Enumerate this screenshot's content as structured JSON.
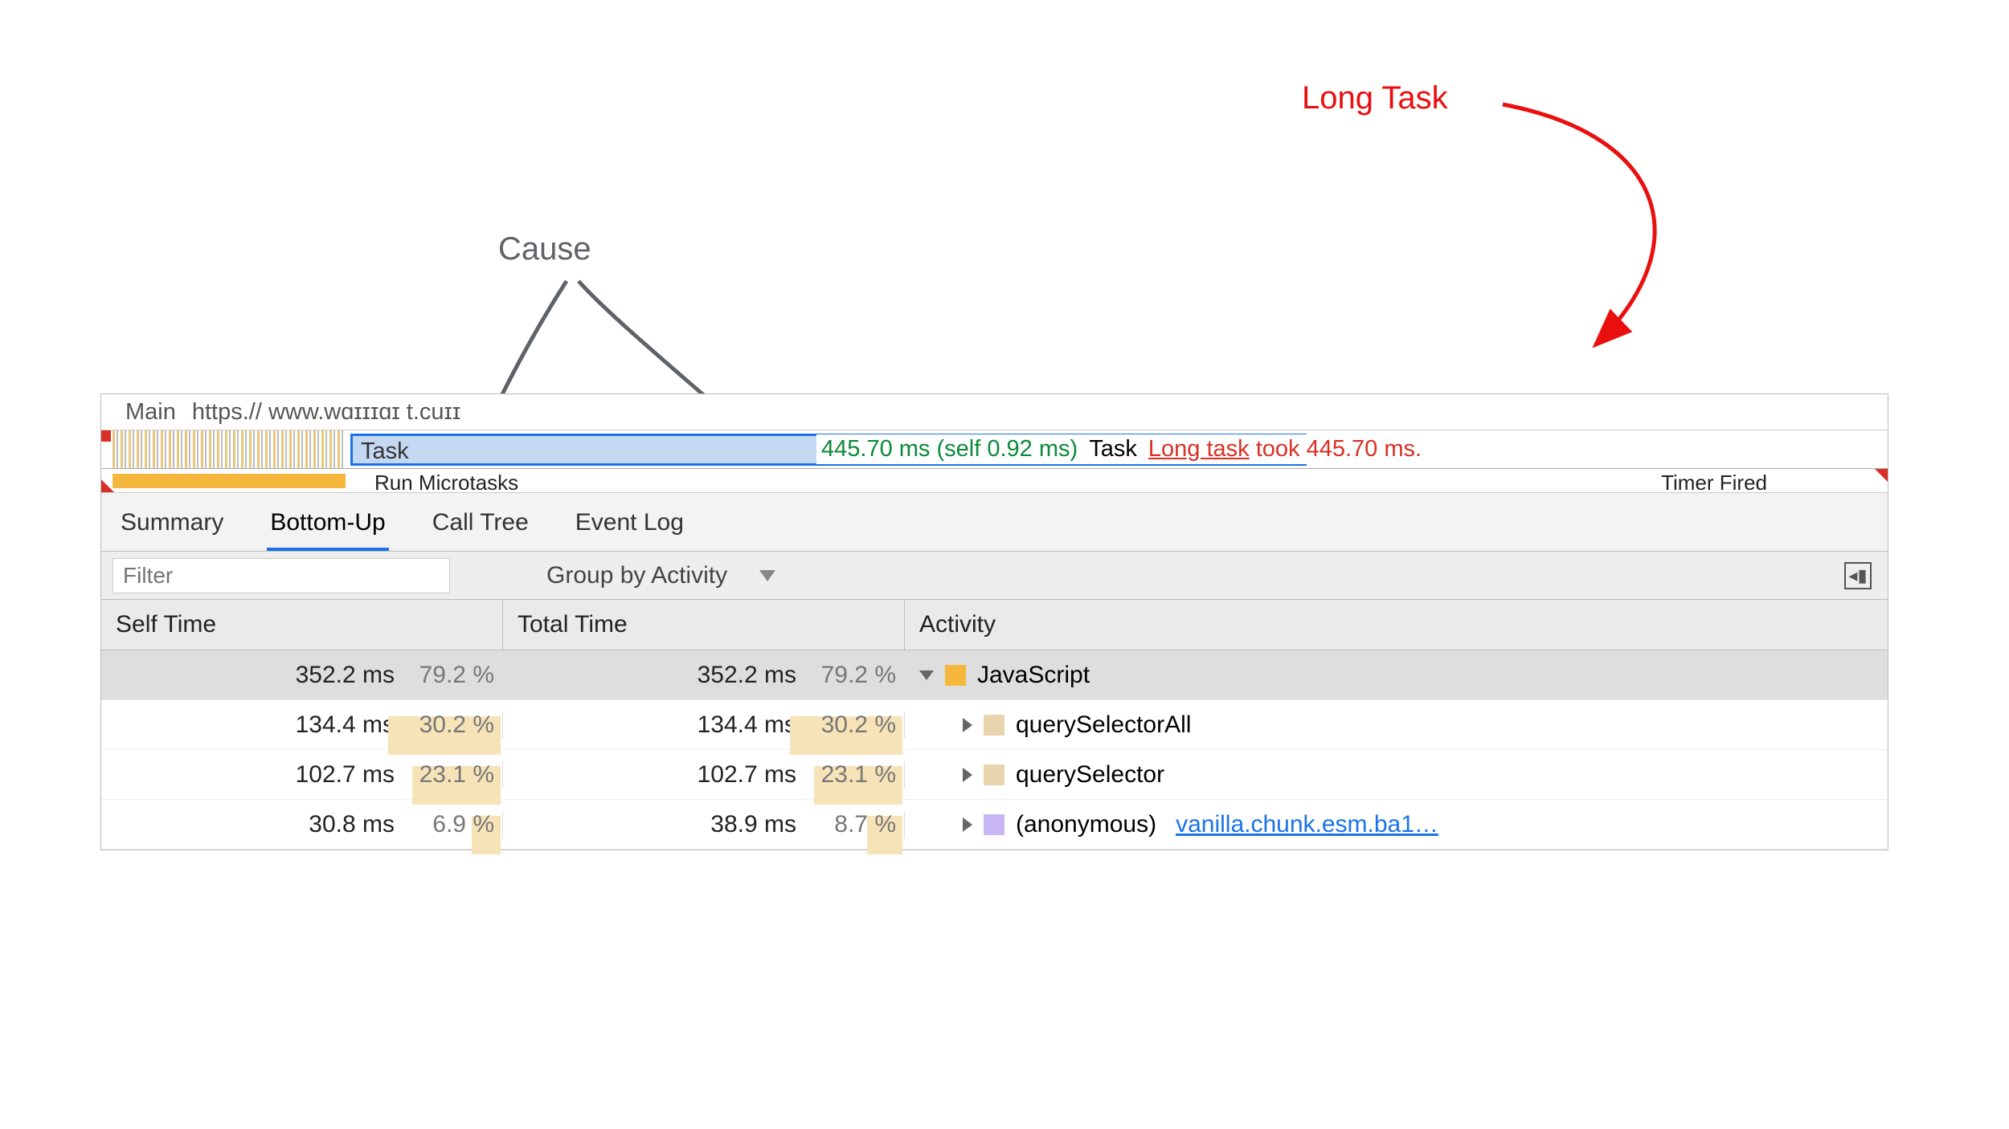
{
  "annotations": {
    "long_task": "Long Task",
    "cause": "Cause"
  },
  "flame": {
    "main_label": "Main",
    "url_fragment": "https.// www.wɑɪɪɪɑɪ t.cuɪɪ",
    "task_label": "Task",
    "tooltip_time": "445.70 ms (self 0.92 ms)",
    "tooltip_task": "Task",
    "tooltip_long_prefix": "Long task",
    "tooltip_long_suffix": " took 445.70 ms.",
    "subrow_micro": "Run Microtasks",
    "subrow_timer": "Timer Fired"
  },
  "tabs": {
    "summary": "Summary",
    "bottom_up": "Bottom-Up",
    "call_tree": "Call Tree",
    "event_log": "Event Log"
  },
  "filter": {
    "placeholder": "Filter",
    "group_by": "Group by Activity"
  },
  "columns": {
    "self": "Self Time",
    "total": "Total Time",
    "activity": "Activity"
  },
  "rows": [
    {
      "self_ms": "352.2 ms",
      "self_pct": "79.2 %",
      "self_bar": 0,
      "total_ms": "352.2 ms",
      "total_pct": "79.2 %",
      "total_bar": 0,
      "expanded": true,
      "swatch": "sw-yellow",
      "activity": "JavaScript",
      "link": "",
      "selected": true,
      "indent": 0
    },
    {
      "self_ms": "134.4 ms",
      "self_pct": "30.2 %",
      "self_bar": 140,
      "total_ms": "134.4 ms",
      "total_pct": "30.2 %",
      "total_bar": 140,
      "expanded": false,
      "swatch": "sw-tan",
      "activity": "querySelectorAll",
      "link": "",
      "selected": false,
      "indent": 1
    },
    {
      "self_ms": "102.7 ms",
      "self_pct": "23.1 %",
      "self_bar": 110,
      "total_ms": "102.7 ms",
      "total_pct": "23.1 %",
      "total_bar": 110,
      "expanded": false,
      "swatch": "sw-tan",
      "activity": "querySelector",
      "link": "",
      "selected": false,
      "indent": 1
    },
    {
      "self_ms": "30.8 ms",
      "self_pct": "6.9 %",
      "self_bar": 36,
      "total_ms": "38.9 ms",
      "total_pct": "8.7 %",
      "total_bar": 44,
      "expanded": false,
      "swatch": "sw-purple",
      "activity": "(anonymous)",
      "link": "vanilla.chunk.esm.ba1…",
      "selected": false,
      "indent": 1
    }
  ]
}
